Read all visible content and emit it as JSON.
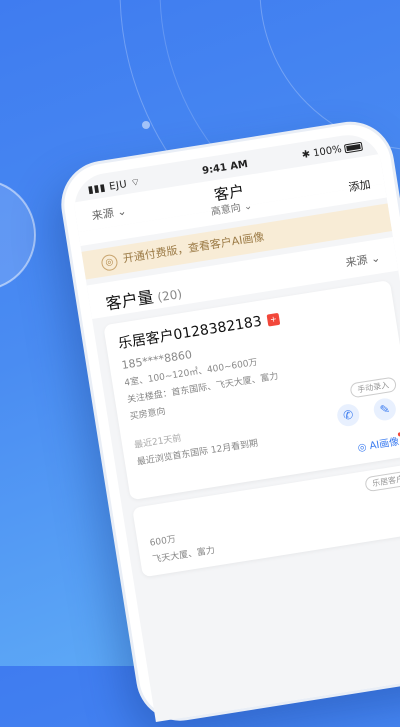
{
  "status_bar": {
    "carrier": "EJU",
    "time": "9:41 AM",
    "battery": "100%"
  },
  "nav": {
    "source_filter": "来源",
    "title": "客户",
    "intent_filter": "高意向",
    "add_label": "添加"
  },
  "banner": {
    "text": "开通付费版，查看客户AI画像"
  },
  "customer_count": {
    "label": "客户量",
    "count": "(20)",
    "source_filter": "来源"
  },
  "card1": {
    "name": "乐居客户0128382183",
    "tag": "+",
    "phone": "185****8860",
    "line1": "4室、100~120㎡、400~600万",
    "line2": "关注楼盘：首东国际、飞天大厦、富力",
    "line3": "买房意向",
    "pill": "手动录入",
    "last_visit": "最近21天前",
    "meta": "最近浏览首东国际 12月看到期",
    "ai_label": "AI画像"
  },
  "card2": {
    "line1": "600万",
    "line2": "飞天大厦、富力",
    "pill": "乐居客户"
  },
  "colors": {
    "accent": "#3a7bf0",
    "banner_bg": "#f8ecd6",
    "tag_red": "#f2473a"
  },
  "icons": [
    "signal-icon",
    "wifi-icon",
    "bluetooth-icon",
    "battery-icon",
    "phone-icon",
    "edit-icon",
    "ai-icon"
  ]
}
